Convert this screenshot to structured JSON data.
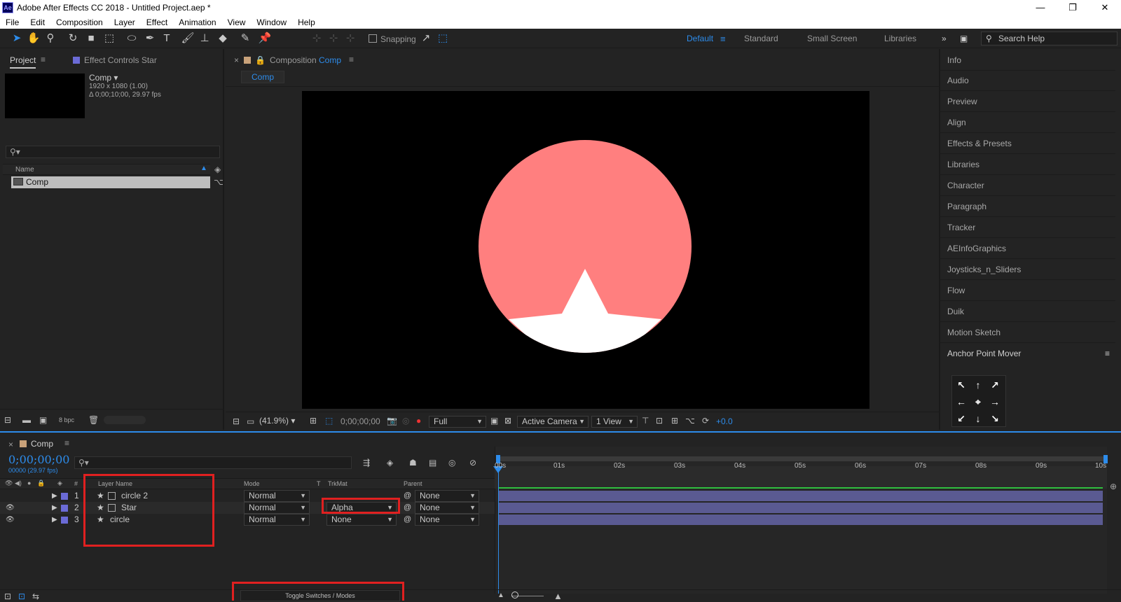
{
  "window": {
    "title": "Adobe After Effects CC 2018 - Untitled Project.aep *",
    "app_icon": "Ae",
    "controls": [
      "—",
      "❐",
      "✕"
    ]
  },
  "menu": [
    "File",
    "Edit",
    "Composition",
    "Layer",
    "Effect",
    "Animation",
    "View",
    "Window",
    "Help"
  ],
  "toolbar": {
    "snapping_label": "Snapping",
    "workspaces": [
      "Default",
      "Standard",
      "Small Screen",
      "Libraries"
    ],
    "active_workspace": "Default",
    "search_placeholder": "Search Help"
  },
  "project_panel": {
    "tab_project": "Project",
    "tab_effect_controls": "Effect Controls Star",
    "item_name": "Comp",
    "item_dims": "1920 x 1080 (1.00)",
    "item_duration": "Δ 0;00;10;00, 29.97 fps",
    "col_name": "Name",
    "rows": [
      {
        "name": "Comp"
      }
    ],
    "bpc": "8 bpc"
  },
  "composition_panel": {
    "tab_prefix": "Composition",
    "tab_name": "Comp",
    "sub_tab": "Comp",
    "zoom": "(41.9%)",
    "timecode": "0;00;00;00",
    "resolution": "Full",
    "camera": "Active Camera",
    "views": "1 View",
    "exposure": "+0.0",
    "circle_color": "#ff7f7f",
    "star_color": "#ffffff"
  },
  "right_panel": {
    "items": [
      "Info",
      "Audio",
      "Preview",
      "Align",
      "Effects & Presets",
      "Libraries",
      "Character",
      "Paragraph",
      "Tracker",
      "AEInfoGraphics",
      "Joysticks_n_Sliders",
      "Flow",
      "Duik",
      "Motion Sketch"
    ],
    "anchor_title": "Anchor Point Mover",
    "anchor_buttons": [
      "↖",
      "↑",
      "↗",
      "←",
      "⌖",
      "→",
      "↙",
      "↓",
      "↘"
    ]
  },
  "timeline": {
    "tab": "Comp",
    "timecode": "0;00;00;00",
    "frame_info": "00000 (29.97 fps)",
    "col_layer_name": "Layer Name",
    "col_mode": "Mode",
    "col_t": "T",
    "col_trkmat": "TrkMat",
    "col_parent": "Parent",
    "col_num": "#",
    "layers": [
      {
        "num": "1",
        "name": "circle 2",
        "mode": "Normal",
        "trkmat": "",
        "parent": "None"
      },
      {
        "num": "2",
        "name": "Star",
        "mode": "Normal",
        "trkmat": "Alpha",
        "parent": "None"
      },
      {
        "num": "3",
        "name": "circle",
        "mode": "Normal",
        "trkmat": "None",
        "parent": "None"
      }
    ],
    "ruler": [
      "00s",
      "01s",
      "02s",
      "03s",
      "04s",
      "05s",
      "06s",
      "07s",
      "08s",
      "09s",
      "10s"
    ],
    "toggle_label": "Toggle Switches / Modes"
  },
  "colors": {
    "accent": "#2d8ceb",
    "layer_label": "#6b6bd6",
    "highlight": "#e02020"
  }
}
